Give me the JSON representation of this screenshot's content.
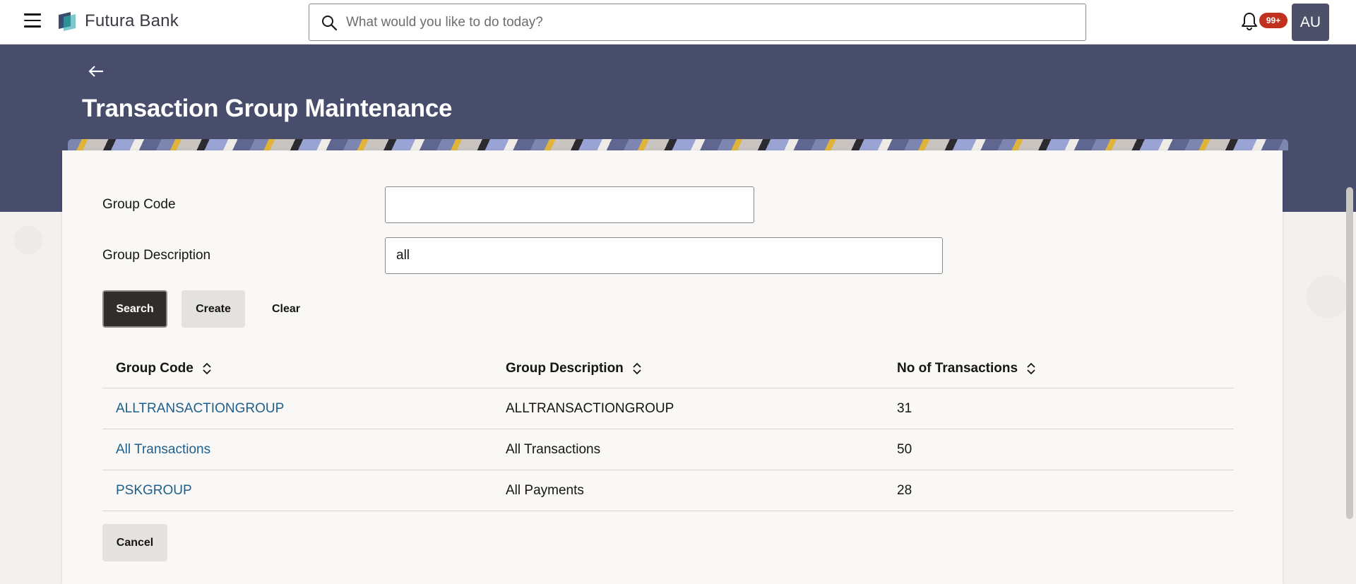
{
  "app": {
    "brand": "Futura Bank",
    "search_placeholder": "What would you like to do today?",
    "notification_badge": "99+",
    "avatar_initials": "AU"
  },
  "page": {
    "title": "Transaction Group Maintenance"
  },
  "form": {
    "group_code_label": "Group Code",
    "group_code_value": "",
    "group_description_label": "Group Description",
    "group_description_value": "all"
  },
  "buttons": {
    "search": "Search",
    "create": "Create",
    "clear": "Clear",
    "cancel": "Cancel"
  },
  "table": {
    "headers": [
      "Group Code",
      "Group Description",
      "No of Transactions"
    ],
    "rows": [
      {
        "code": "ALLTRANSACTIONGROUP",
        "description": "ALLTRANSACTIONGROUP",
        "count": "31"
      },
      {
        "code": "All Transactions",
        "description": "All Transactions",
        "count": "50"
      },
      {
        "code": "PSKGROUP",
        "description": "All Payments",
        "count": "28"
      }
    ]
  },
  "colors": {
    "header_band": "#474d6b",
    "primary_button": "#312d2a",
    "link": "#1f5f8a",
    "badge": "#c0321f",
    "avatar": "#4c5068"
  },
  "icons": [
    "hamburger-menu-icon",
    "bank-logo-icon",
    "search-icon",
    "bell-icon",
    "back-arrow-icon",
    "sort-icon"
  ]
}
